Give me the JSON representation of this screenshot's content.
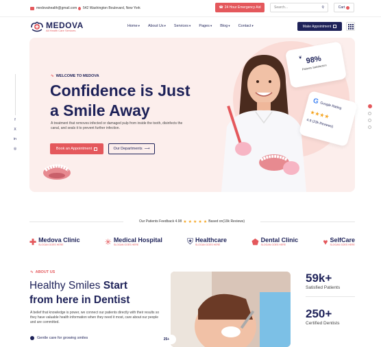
{
  "topbar": {
    "email": "medovahealth@gmail.com",
    "address": "542 Washington Boulevard, New York",
    "emergency_label": "24 Hour Emergency Aid",
    "search_placeholder": "Search...",
    "cart_label": "Cart",
    "accent_color": "#e4585c"
  },
  "header": {
    "logo_name": "MEDOVA",
    "logo_sub": "All Health Care Services",
    "nav": [
      "Home",
      "About Us",
      "Services",
      "Pages",
      "Blog",
      "Contact"
    ],
    "cta_label": "Make Appointment",
    "primary_color": "#1d2158"
  },
  "hero": {
    "welcome": "WELCOME TO MEDOVA",
    "title_line1": "Confidence is Just",
    "title_line2": "a Smile Away",
    "description": "A treatment that removes infected or damaged pulp from inside the tooth, disinfects the canal, and seals it to prevent further infection.",
    "btn_appointment": "Book an Appointment",
    "btn_departments": "Our Departments",
    "satisfaction_percent": "98%",
    "satisfaction_label": "Patients Satisfaction",
    "google_label": "Google Rating",
    "google_rating": "4.9 (23k Reviews)",
    "social": [
      "f",
      "X",
      "in",
      "◎"
    ]
  },
  "feedback": {
    "label": "Our Patients Feedback 4.98",
    "stars": 5,
    "reviews": "Based on(19k Reviews)"
  },
  "brands": [
    {
      "name": "Medova Clinic",
      "slogan": "SLOGAN GOES HERE",
      "icon": "cross-icon"
    },
    {
      "name": "Medical Hospital",
      "slogan": "SLOGAN GOES HERE",
      "icon": "medical-star-icon"
    },
    {
      "name": "Healthcare",
      "slogan": "SLOGAN GOES HERE",
      "icon": "shield-cross-icon"
    },
    {
      "name": "Dental Clinic",
      "slogan": "SLOGAN GOES HERE",
      "icon": "tooth-icon"
    },
    {
      "name": "SelfCare",
      "slogan": "SLOGAN GOES HERE",
      "icon": "heart-plus-icon"
    }
  ],
  "about": {
    "tag": "ABOUT US",
    "heading_a": "Healthy Smiles ",
    "heading_b": "Start",
    "heading_c": "from here in Dentist",
    "description": "A belief that knowledge is power, we connect our patients directly with their results so they have valuable health information when they need it most, care about our people and are committed.",
    "list_item": "Gentle care for growing smiles",
    "badge": "25+"
  },
  "stats": [
    {
      "value": "59k+",
      "label": "Satisfied Patients"
    },
    {
      "value": "250+",
      "label": "Certified Dentists"
    }
  ]
}
